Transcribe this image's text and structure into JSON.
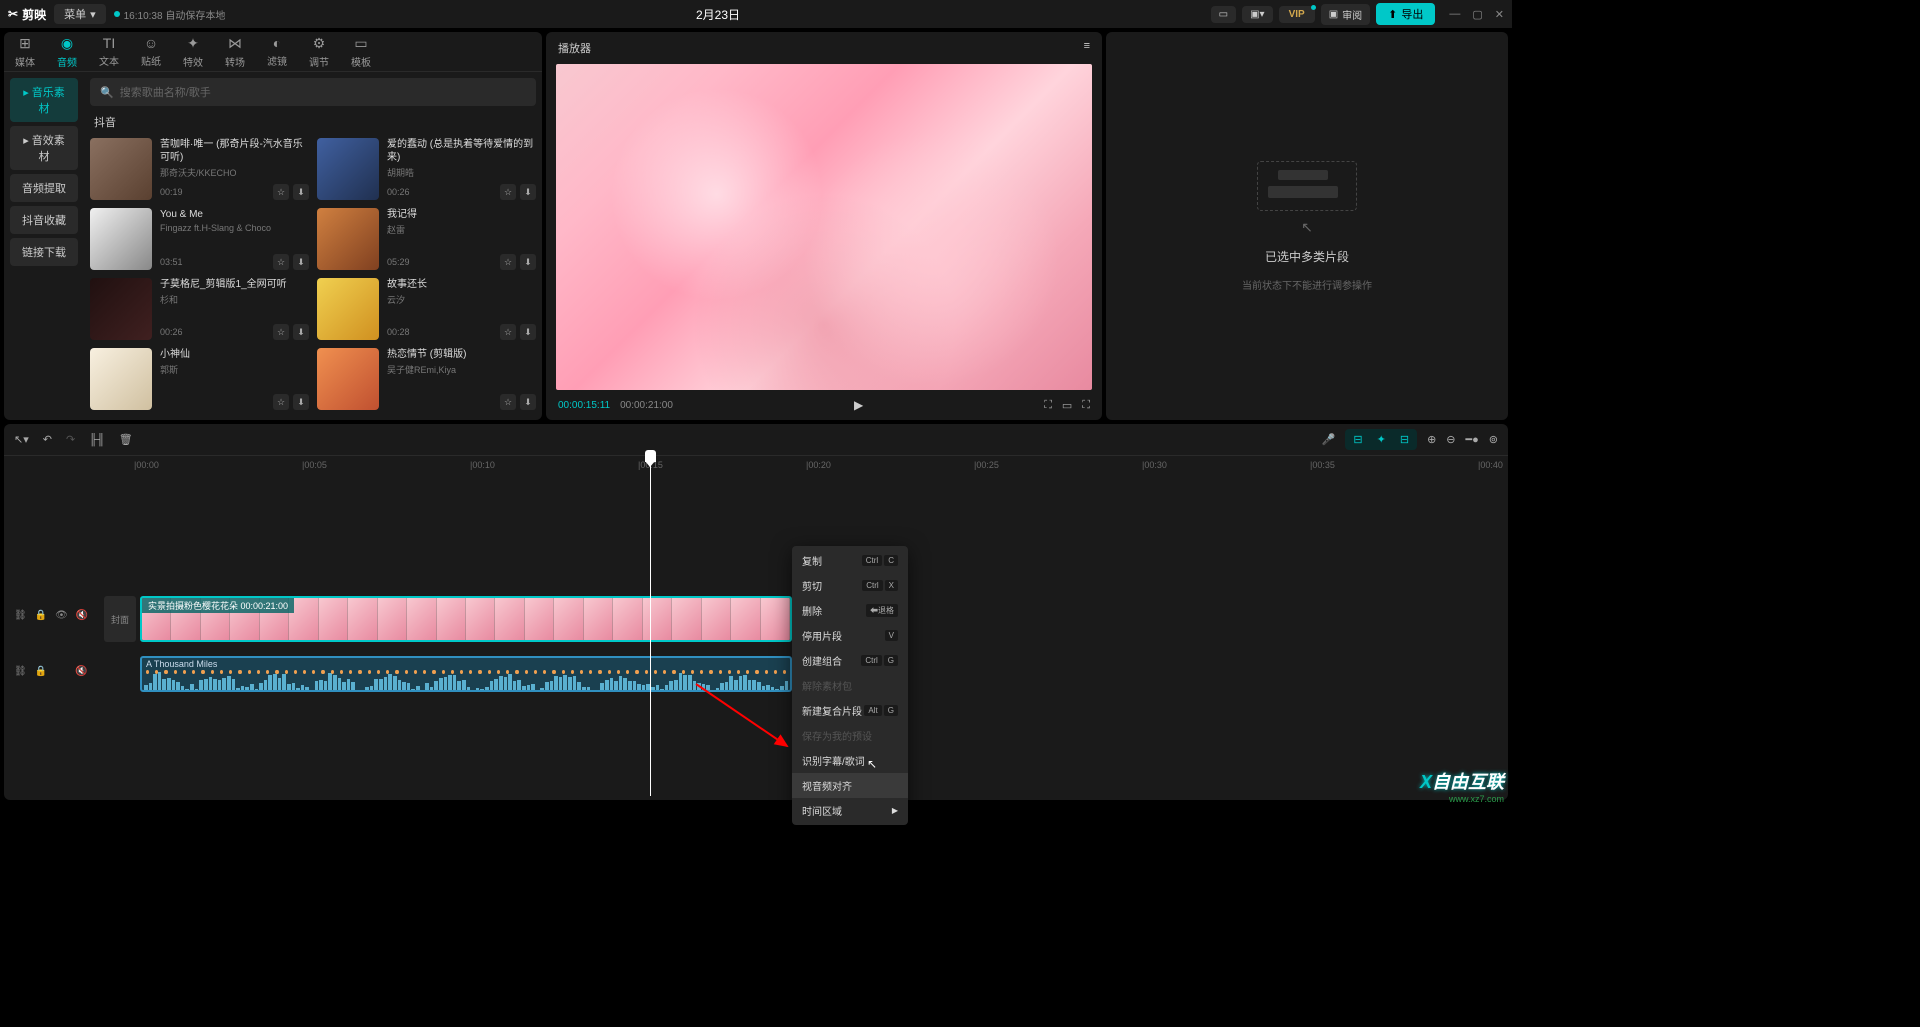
{
  "titlebar": {
    "app": "剪映",
    "menu": "菜单",
    "save_time": "16:10:38 自动保存本地",
    "project": "2月23日",
    "vip": "VIP",
    "review": "审阅",
    "export": "导出"
  },
  "tool_tabs": [
    {
      "icon": "⊞",
      "label": "媒体"
    },
    {
      "icon": "◉",
      "label": "音频"
    },
    {
      "icon": "TI",
      "label": "文本"
    },
    {
      "icon": "☺",
      "label": "贴纸"
    },
    {
      "icon": "✦",
      "label": "特效"
    },
    {
      "icon": "⋈",
      "label": "转场"
    },
    {
      "icon": "◐",
      "label": "滤镜"
    },
    {
      "icon": "⚙",
      "label": "调节"
    },
    {
      "icon": "▭",
      "label": "模板"
    }
  ],
  "side_nav": [
    "音乐素材",
    "音效素材",
    "音频提取",
    "抖音收藏",
    "链接下载"
  ],
  "search": {
    "placeholder": "搜索歌曲名称/歌手"
  },
  "section": "抖音",
  "music": [
    {
      "title": "苦咖啡·唯一 (那奇片段-汽水音乐可听)",
      "artist": "那奇沃夫/KKECHO",
      "dur": "00:19"
    },
    {
      "title": "爱的蠢动 (总是执着等待爱情的到来)",
      "artist": "胡期皓",
      "dur": "00:26"
    },
    {
      "title": "You & Me",
      "artist": "Fingazz ft.H-Slang & Choco",
      "dur": "03:51"
    },
    {
      "title": "我记得",
      "artist": "赵雷",
      "dur": "05:29"
    },
    {
      "title": "子莫格尼_剪辑版1_全网可听",
      "artist": "杉和",
      "dur": "00:26"
    },
    {
      "title": "故事还长",
      "artist": "云汐",
      "dur": "00:28"
    },
    {
      "title": "小神仙",
      "artist": "郭斯",
      "dur": ""
    },
    {
      "title": "热恋情节 (剪辑版)",
      "artist": "吴子健REmi,Kiya",
      "dur": ""
    }
  ],
  "preview": {
    "title": "播放器",
    "cur": "00:00:15:11",
    "tot": "00:00:21:00"
  },
  "right_panel": {
    "line1": "已选中多类片段",
    "line2": "当前状态下不能进行调参操作"
  },
  "ruler": [
    "00:00",
    "00:05",
    "00:10",
    "00:15",
    "00:20",
    "00:25",
    "00:30",
    "00:35",
    "00:40"
  ],
  "timeline": {
    "cover": "封面",
    "video_label": "实景拍摄粉色樱花花朵   00:00:21:00",
    "audio_label": "A Thousand Miles"
  },
  "ctx": [
    {
      "label": "复制",
      "k1": "Ctrl",
      "k2": "C"
    },
    {
      "label": "剪切",
      "k1": "Ctrl",
      "k2": "X"
    },
    {
      "label": "删除",
      "k1": "⬅退格",
      "k2": ""
    },
    {
      "label": "停用片段",
      "k1": "",
      "k2": "V"
    },
    {
      "label": "创建组合",
      "k1": "Ctrl",
      "k2": "G"
    },
    {
      "label": "解除素材包",
      "disabled": true
    },
    {
      "label": "新建复合片段",
      "k1": "Alt",
      "k2": "G"
    },
    {
      "label": "保存为我的预设",
      "disabled": true
    },
    {
      "label": "识别字幕/歌词"
    },
    {
      "label": "视音频对齐",
      "hl": true
    },
    {
      "label": "时间区域",
      "sub": true
    }
  ],
  "watermark": {
    "main_pre": "自由互联",
    "url": "www.xz7.com"
  }
}
